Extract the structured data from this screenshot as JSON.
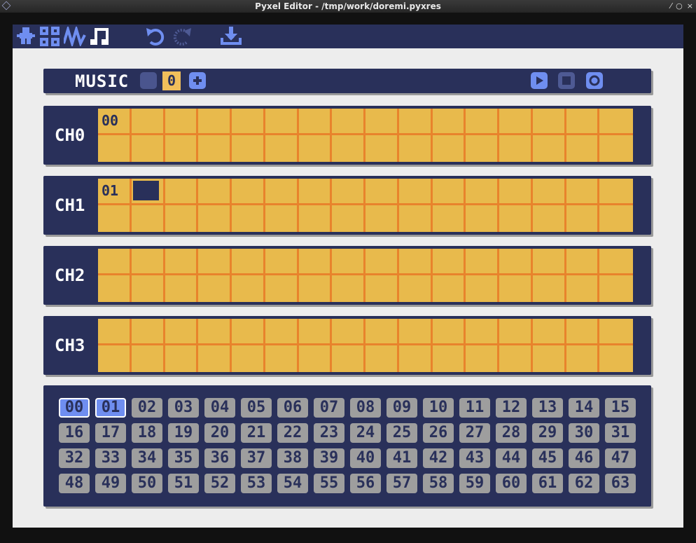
{
  "window": {
    "title": "Pyxel Editor - /tmp/work/doremi.pyxres"
  },
  "toolbar": {
    "tools": [
      {
        "name": "image-editor-icon",
        "active": false
      },
      {
        "name": "tilemap-editor-icon",
        "active": false
      },
      {
        "name": "sound-editor-icon",
        "active": false
      },
      {
        "name": "music-editor-icon",
        "active": true
      }
    ],
    "undo": "undo-icon",
    "redo": "redo-icon",
    "save": "save-icon"
  },
  "music_bar": {
    "label": "MUSIC",
    "number": "0"
  },
  "channels": [
    {
      "label": "CH0",
      "sequence": [
        "00"
      ],
      "cursor_at": null
    },
    {
      "label": "CH1",
      "sequence": [
        "01"
      ],
      "cursor_at": 1
    },
    {
      "label": "CH2",
      "sequence": [],
      "cursor_at": null
    },
    {
      "label": "CH3",
      "sequence": [],
      "cursor_at": null
    }
  ],
  "patterns": {
    "labels": [
      "00",
      "01",
      "02",
      "03",
      "04",
      "05",
      "06",
      "07",
      "08",
      "09",
      "10",
      "11",
      "12",
      "13",
      "14",
      "15",
      "16",
      "17",
      "18",
      "19",
      "20",
      "21",
      "22",
      "23",
      "24",
      "25",
      "26",
      "27",
      "28",
      "29",
      "30",
      "31",
      "32",
      "33",
      "34",
      "35",
      "36",
      "37",
      "38",
      "39",
      "40",
      "41",
      "42",
      "43",
      "44",
      "45",
      "46",
      "47",
      "48",
      "49",
      "50",
      "51",
      "52",
      "53",
      "54",
      "55",
      "56",
      "57",
      "58",
      "59",
      "60",
      "61",
      "62",
      "63"
    ],
    "highlighted": [
      "00",
      "01"
    ]
  },
  "colors": {
    "navy": "#29305a",
    "yellow": "#e8ba4c",
    "orange": "#e8832c",
    "highlight": "#6f8ef0",
    "gray": "#9e9e9e"
  }
}
